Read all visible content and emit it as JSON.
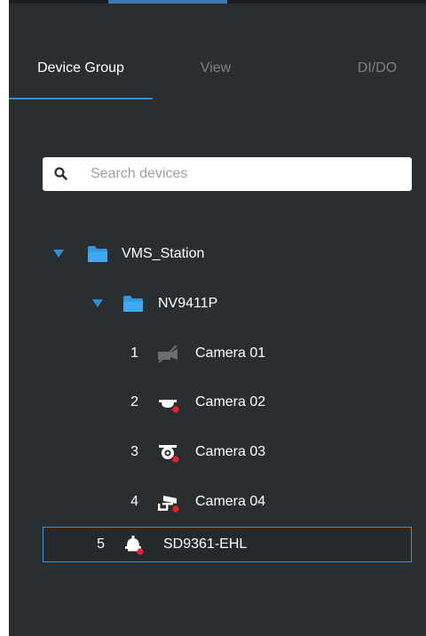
{
  "tabs": [
    {
      "label": "Device Group",
      "active": true
    },
    {
      "label": "View",
      "active": false
    },
    {
      "label": "DI/DO",
      "active": false
    }
  ],
  "search": {
    "placeholder": "Search devices",
    "value": ""
  },
  "tree": {
    "station": {
      "label": "VMS_Station",
      "expanded": true
    },
    "nvr": {
      "label": "NV9411P",
      "expanded": true
    },
    "cameras": [
      {
        "index": "1",
        "label": "Camera 01",
        "icon": "camera-disconnected-icon"
      },
      {
        "index": "2",
        "label": "Camera 02",
        "icon": "dome-camera-icon"
      },
      {
        "index": "3",
        "label": "Camera 03",
        "icon": "fisheye-camera-icon"
      },
      {
        "index": "4",
        "label": "Camera 04",
        "icon": "bullet-camera-icon"
      }
    ],
    "device": {
      "index": "5",
      "label": "SD9361-EHL",
      "icon": "speed-dome-camera-icon",
      "selected": true
    }
  },
  "colors": {
    "panel_bg": "#2a2e31",
    "accent": "#2f8fd6",
    "folder": "#2f9be6",
    "status_dot": "#e8212b",
    "inactive_text": "#7c8186"
  }
}
